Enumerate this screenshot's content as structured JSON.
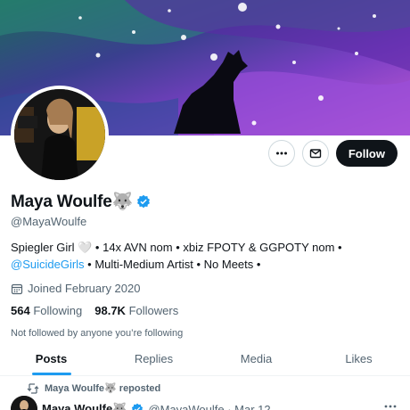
{
  "profile": {
    "display_name": "Maya Woulfe🐺",
    "handle": "@MayaWoulfe",
    "bio_text": "Spiegler Girl 🤍 • 14x AVN nom • xbiz FPOTY & GGPOTY nom • ",
    "bio_mention": "@SuicideGirls",
    "bio_tail": " • Multi-Medium Artist • No Meets •",
    "joined": "Joined February 2020",
    "following_count": "564",
    "following_label": "Following",
    "followers_count": "98.7K",
    "followers_label": "Followers",
    "not_followed": "Not followed by anyone you’re following"
  },
  "actions": {
    "follow_label": "Follow"
  },
  "tabs": [
    {
      "label": "Posts",
      "active": true
    },
    {
      "label": "Replies",
      "active": false
    },
    {
      "label": "Media",
      "active": false
    },
    {
      "label": "Likes",
      "active": false
    }
  ],
  "feed": {
    "repost_text": "Maya Woulfe🐺 reposted",
    "post_name": "Maya Woulfe🐺",
    "post_meta": "@MayaWoulfe · Mar 12"
  },
  "colors": {
    "accent": "#1d9bf0",
    "text": "#0f1419",
    "muted": "#536471",
    "banner_purple": "#7a3fc4"
  },
  "icons": [
    "more-icon",
    "mail-icon",
    "verified-badge-icon",
    "calendar-icon",
    "repost-icon"
  ]
}
